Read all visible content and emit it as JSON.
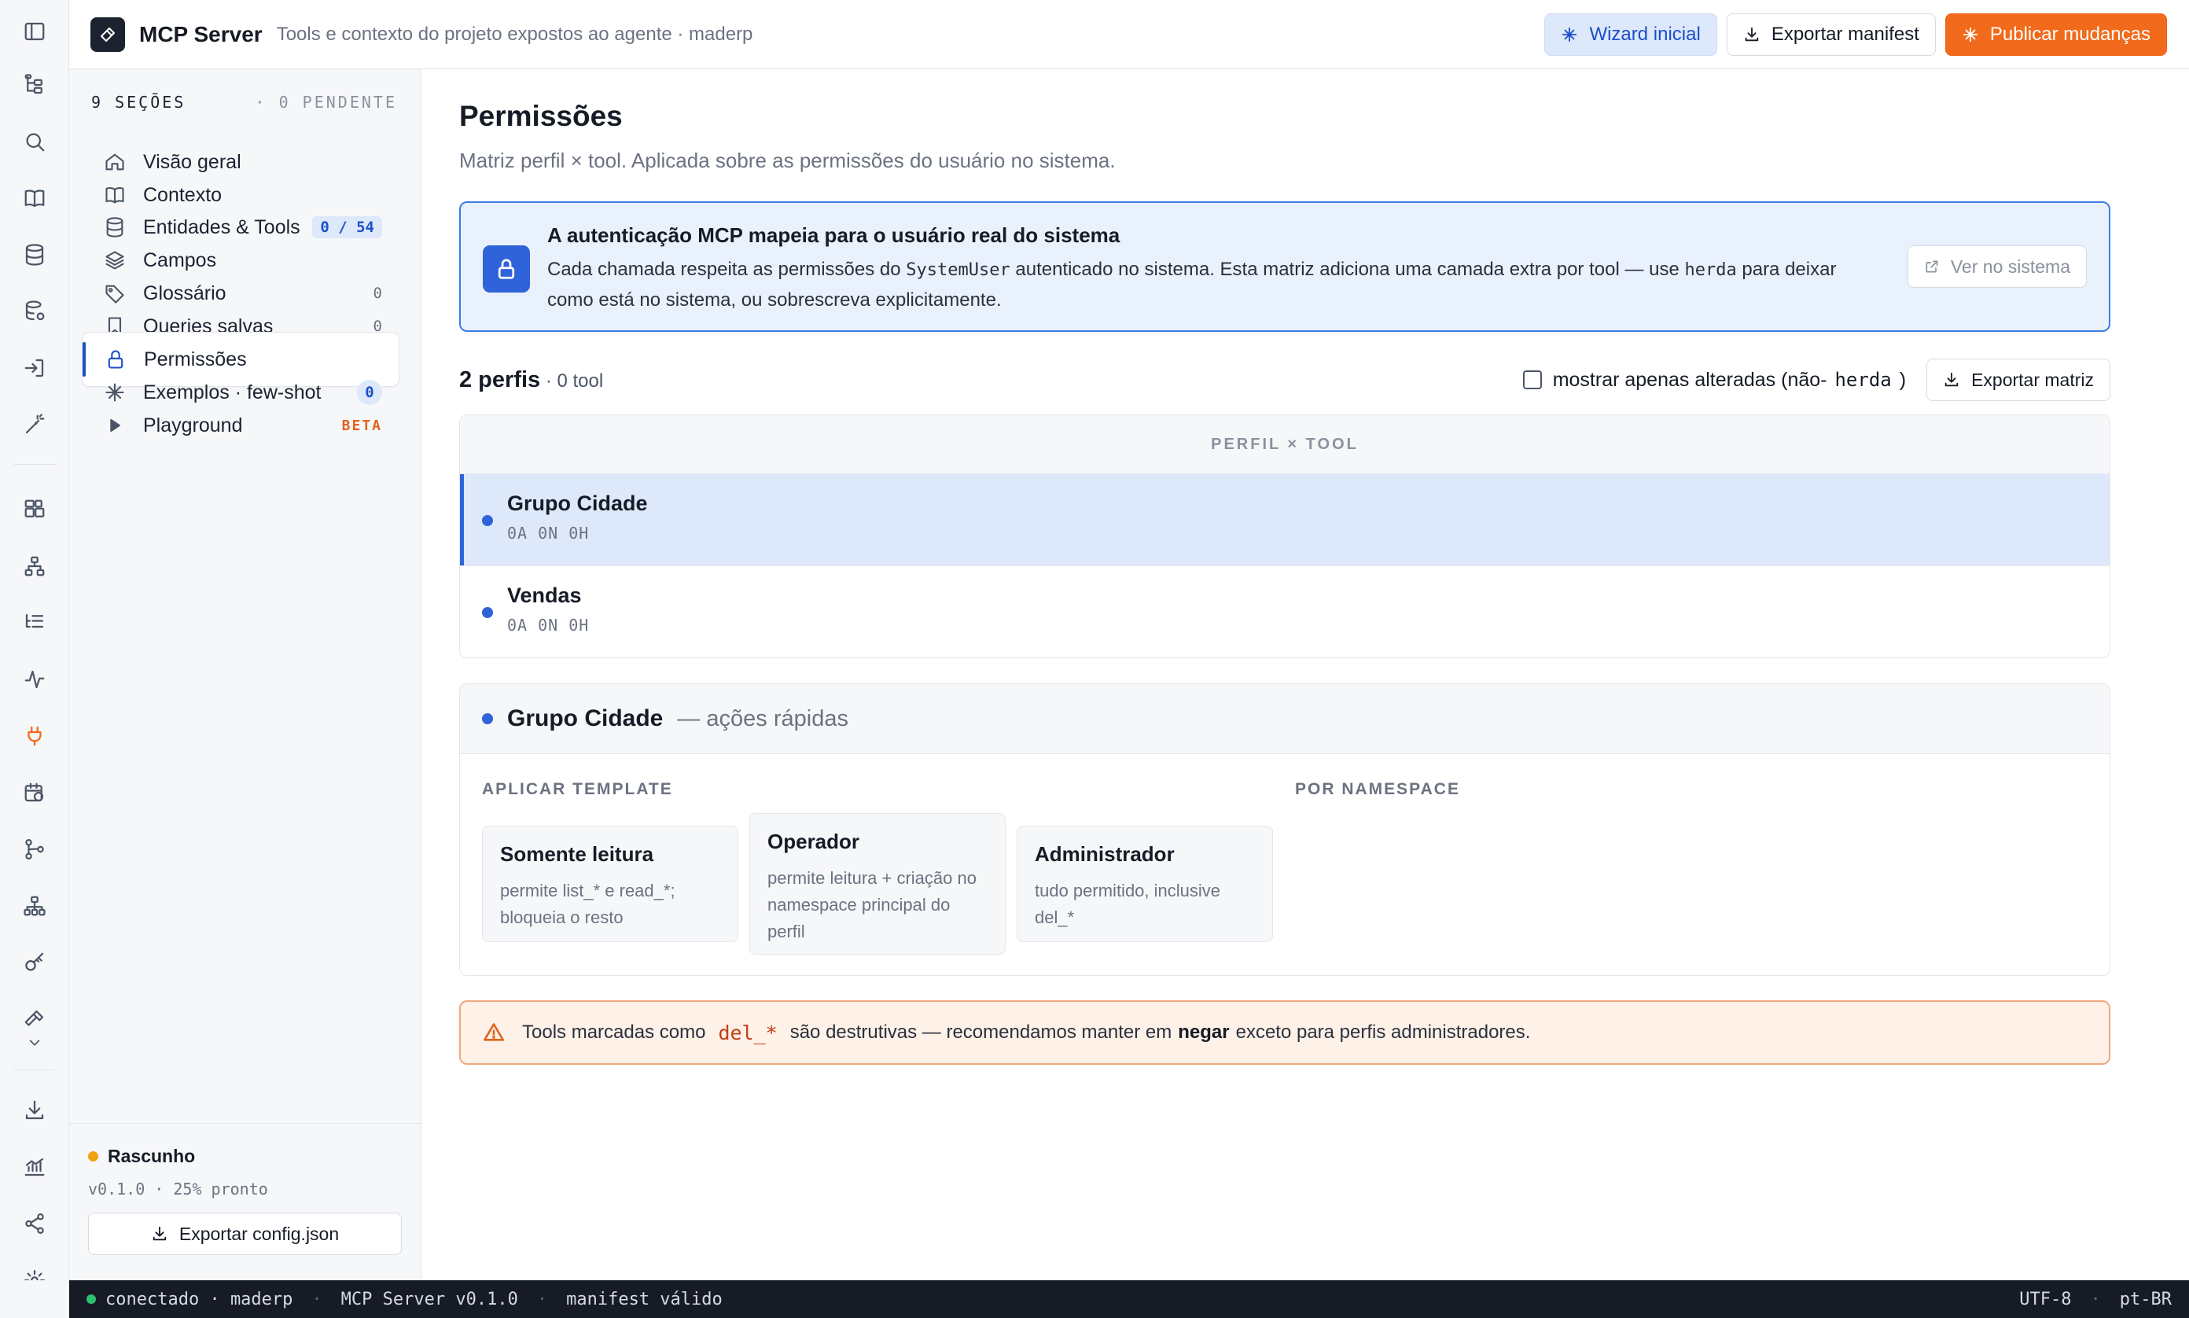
{
  "header": {
    "title": "MCP Server",
    "subtitle": "Tools e contexto do projeto expostos ao agente · maderp",
    "wizard_label": "Wizard inicial",
    "export_manifest_label": "Exportar manifest",
    "publish_label": "Publicar mudanças"
  },
  "rail": {
    "icons": [
      "panel-toggle-icon",
      "tree-icon",
      "search-icon",
      "book-icon",
      "database-icon",
      "database-gear-icon",
      "import-icon",
      "magic-wand-icon",
      "widgets-icon",
      "hierarchy-icon",
      "list-tree-icon",
      "activity-icon",
      "plug-icon",
      "calendar-clock-icon",
      "git-branch-icon",
      "sitemap-icon",
      "key-icon",
      "hammer-icon",
      "chevron-down-icon",
      "download-icon",
      "chart-icon",
      "share-icon",
      "settings-icon"
    ],
    "active": "plug-icon",
    "accent": "#f26a1b"
  },
  "sidebar": {
    "sections_count": "9 SEÇÕES",
    "pending": "· 0 PENDENTE",
    "items": [
      {
        "label": "Visão geral",
        "icon": "home-icon",
        "badge": ""
      },
      {
        "label": "Contexto",
        "icon": "book-open-icon",
        "badge": ""
      },
      {
        "label": "Entidades & Tools",
        "icon": "database-icon",
        "badge": "0 / 54"
      },
      {
        "label": "Campos",
        "icon": "layers-icon",
        "badge": ""
      },
      {
        "label": "Glossário",
        "icon": "tag-icon",
        "badge": "0"
      },
      {
        "label": "Queries salvas",
        "icon": "bookmark-icon",
        "badge": "0"
      },
      {
        "label": "Permissões",
        "icon": "lock-icon",
        "badge": ""
      },
      {
        "label": "Exemplos · few-shot",
        "icon": "sparkle-icon",
        "badge": "0"
      },
      {
        "label": "Playground",
        "icon": "play-icon",
        "badge": "BETA"
      }
    ],
    "active_item": "Permissões",
    "footer": {
      "status": "Rascunho",
      "meta": "v0.1.0 · 25% pronto",
      "export_label": "Exportar config.json"
    }
  },
  "main": {
    "title": "Permissões",
    "subtitle": "Matriz perfil × tool. Aplicada sobre as permissões do usuário no sistema.",
    "info": {
      "title": "A autenticação MCP mapeia para o usuário real do sistema",
      "text_1": "Cada chamada respeita as permissões do ",
      "code_1": "SystemUser",
      "text_2": " autenticado no sistema. Esta matriz adiciona uma camada extra por tool — use ",
      "code_2": "herda",
      "text_3": " para deixar como está no sistema, ou sobrescreva explicitamente.",
      "button_label": "Ver no sistema"
    },
    "summary": {
      "profiles": "2 perfis",
      "tools": " · 0 tool",
      "filter_prefix": "mostrar apenas alteradas (não-",
      "filter_code": "herda",
      "filter_suffix": ")",
      "export_matrix_label": "Exportar matriz"
    },
    "matrix": {
      "header": "PERFIL × TOOL",
      "rows": [
        {
          "name": "Grupo Cidade",
          "meta": "0A 0N 0H",
          "selected": true
        },
        {
          "name": "Vendas",
          "meta": "0A 0N 0H",
          "selected": false
        }
      ]
    },
    "quick_actions": {
      "profile": "Grupo Cidade",
      "suffix": "— ações rápidas",
      "templates_label": "APLICAR TEMPLATE",
      "namespace_label": "POR NAMESPACE",
      "templates": [
        {
          "name": "Somente leitura",
          "desc": "permite list_* e read_*; bloqueia o resto"
        },
        {
          "name": "Operador",
          "desc": "permite leitura + criação no namespace principal do perfil"
        },
        {
          "name": "Administrador",
          "desc": "tudo permitido, inclusive del_*"
        }
      ]
    },
    "warning": {
      "prefix": "Tools marcadas como",
      "code": "del_*",
      "middle": "são destrutivas — recomendamos manter em",
      "strong": "negar",
      "suffix": "exceto para perfis administradores."
    }
  },
  "statusbar": {
    "connection": "conectado · maderp",
    "server": "MCP Server v0.1.0",
    "manifest": "manifest válido",
    "encoding": "UTF-8",
    "locale": "pt-BR"
  },
  "colors": {
    "accent_orange": "#f26a1b",
    "accent_blue": "#2f63d9",
    "info_bg": "#e9f1fd",
    "warn_bg": "#fdf1e8",
    "status_ok": "#2fbf71",
    "draft": "#f0a114"
  }
}
